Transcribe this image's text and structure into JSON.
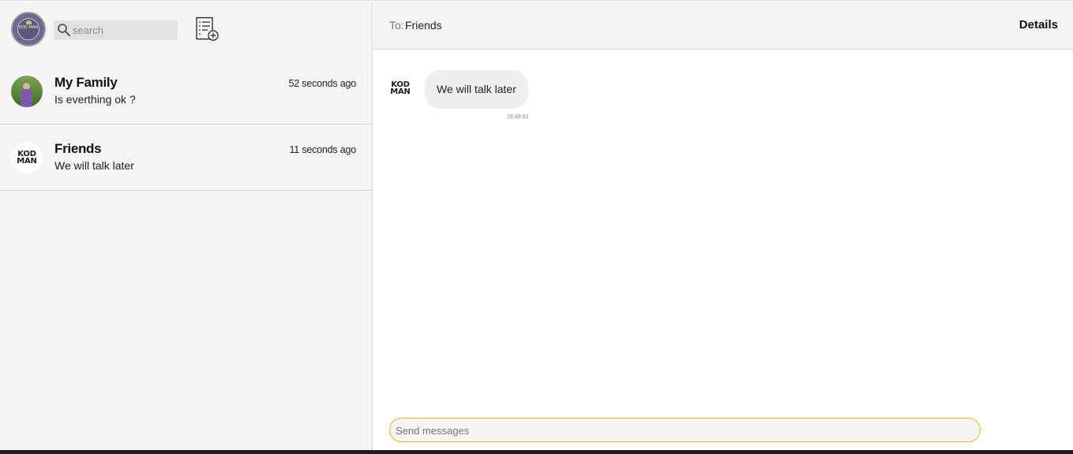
{
  "sidebar": {
    "profile_avatar_text": "KOD MAN",
    "search": {
      "placeholder": "search",
      "value": ""
    },
    "compose_icon": "new-conversation-icon",
    "conversations": [
      {
        "name": "My Family",
        "preview": "Is everthing ok ?",
        "time": "52 seconds ago",
        "avatar": "family-photo"
      },
      {
        "name": "Friends",
        "preview": "We will talk later",
        "time": "11 seconds ago",
        "avatar": "kodman-logo"
      }
    ]
  },
  "chat": {
    "to_label": "To:",
    "recipient": "Friends",
    "details_label": "Details",
    "messages": [
      {
        "text": "We will talk later",
        "time": "16:49:01",
        "avatar": "kodman-logo"
      }
    ],
    "composer": {
      "placeholder": "Send messages",
      "value": ""
    }
  },
  "logo": {
    "line1": "KOD",
    "line2": "MAN"
  },
  "colors": {
    "accent_border": "#e6b81f",
    "sidebar_bg": "#f4f4f4",
    "bubble_bg": "#efefef"
  }
}
